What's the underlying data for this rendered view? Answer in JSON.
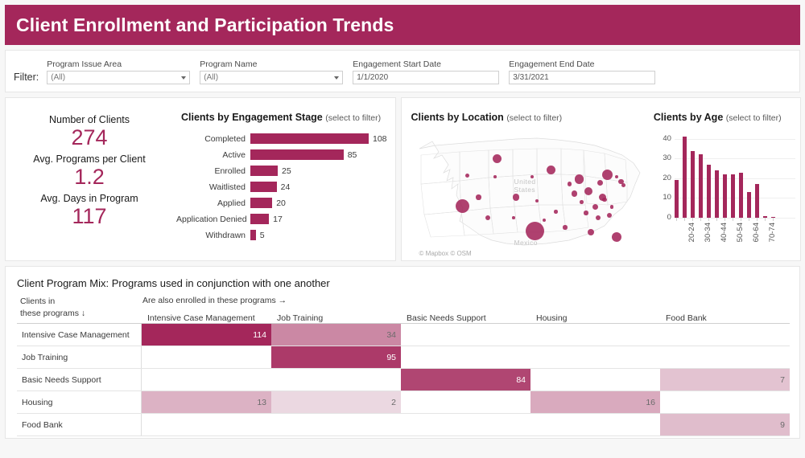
{
  "header": {
    "title": "Client Enrollment and Participation Trends",
    "accent": "#a4275b"
  },
  "filter": {
    "label": "Filter:",
    "controls": [
      {
        "name": "program-issue-area",
        "label": "Program Issue Area",
        "value": "(All)",
        "type": "select"
      },
      {
        "name": "program-name",
        "label": "Program Name",
        "value": "(All)",
        "type": "select"
      },
      {
        "name": "engagement-start-date",
        "label": "Engagement Start Date",
        "value": "1/1/2020",
        "type": "date"
      },
      {
        "name": "engagement-end-date",
        "label": "Engagement End Date",
        "value": "3/31/2021",
        "type": "date"
      }
    ]
  },
  "kpis": [
    {
      "label": "Number of Clients",
      "value": "274"
    },
    {
      "label": "Avg. Programs per Client",
      "value": "1.2"
    },
    {
      "label": "Avg. Days in Program",
      "value": "117"
    }
  ],
  "engagement_stage": {
    "title": "Clients by Engagement Stage",
    "subtitle": "(select to filter)",
    "chart_data": {
      "type": "bar",
      "title": "Clients by Engagement Stage",
      "xlabel": "",
      "ylabel": "",
      "orientation": "horizontal",
      "categories": [
        "Completed",
        "Active",
        "Enrolled",
        "Waitlisted",
        "Applied",
        "Application Denied",
        "Withdrawn"
      ],
      "values": [
        108,
        85,
        25,
        24,
        20,
        17,
        5
      ],
      "xlim": [
        0,
        108
      ],
      "color": "#a4275b",
      "grid": false
    }
  },
  "location": {
    "title": "Clients by Location",
    "subtitle": "(select to filter)",
    "attribution": "© Mapbox  © OSM",
    "map_labels": [
      "United States",
      "Mexico"
    ],
    "chart_data": {
      "type": "scatter",
      "title": "Clients by Location",
      "xlabel": "",
      "ylabel": "",
      "note": "Proportional symbol map of US client counts",
      "points": [
        {
          "x": 37,
          "y": 23,
          "r": 5.5
        },
        {
          "x": 24,
          "y": 37,
          "r": 2.5
        },
        {
          "x": 36,
          "y": 38,
          "r": 1.8
        },
        {
          "x": 22,
          "y": 62,
          "r": 8.5
        },
        {
          "x": 29,
          "y": 55,
          "r": 3.2
        },
        {
          "x": 33,
          "y": 72,
          "r": 3.2
        },
        {
          "x": 44,
          "y": 72,
          "r": 1.8
        },
        {
          "x": 45,
          "y": 55,
          "r": 4.2
        },
        {
          "x": 54,
          "y": 58,
          "r": 2.2
        },
        {
          "x": 52,
          "y": 38,
          "r": 1.9
        },
        {
          "x": 57,
          "y": 74,
          "r": 2.2
        },
        {
          "x": 53,
          "y": 83,
          "r": 11.5
        },
        {
          "x": 62,
          "y": 67,
          "r": 2.2
        },
        {
          "x": 60,
          "y": 32,
          "r": 5.5
        },
        {
          "x": 66,
          "y": 80,
          "r": 2.6
        },
        {
          "x": 68,
          "y": 44,
          "r": 2.7
        },
        {
          "x": 70,
          "y": 52,
          "r": 3.6
        },
        {
          "x": 72,
          "y": 40,
          "r": 5.6
        },
        {
          "x": 73,
          "y": 59,
          "r": 2.3
        },
        {
          "x": 75,
          "y": 68,
          "r": 2.6
        },
        {
          "x": 76,
          "y": 50,
          "r": 5.2
        },
        {
          "x": 77,
          "y": 84,
          "r": 4.0
        },
        {
          "x": 79,
          "y": 63,
          "r": 3.5
        },
        {
          "x": 80,
          "y": 72,
          "r": 3.0
        },
        {
          "x": 81,
          "y": 43,
          "r": 3.6
        },
        {
          "x": 82,
          "y": 55,
          "r": 4.8
        },
        {
          "x": 83,
          "y": 57,
          "r": 2.8
        },
        {
          "x": 84,
          "y": 36,
          "r": 6.5
        },
        {
          "x": 86,
          "y": 63,
          "r": 2.4
        },
        {
          "x": 88,
          "y": 38,
          "r": 2.0
        },
        {
          "x": 90,
          "y": 42,
          "r": 3.4
        },
        {
          "x": 91,
          "y": 45,
          "r": 2.4
        },
        {
          "x": 85,
          "y": 70,
          "r": 3.0
        },
        {
          "x": 88,
          "y": 88,
          "r": 6.0
        }
      ],
      "color": "#a4275b"
    }
  },
  "age": {
    "title": "Clients by Age",
    "subtitle": "(select to filter)",
    "chart_data": {
      "type": "bar",
      "title": "Clients by Age",
      "xlabel": "",
      "ylabel": "",
      "categories": [
        "15-19",
        "20-24",
        "25-29",
        "30-34",
        "35-39",
        "40-44",
        "45-49",
        "50-54",
        "55-59",
        "60-64",
        "65-69",
        "70-74",
        "75-79"
      ],
      "tick_labels": [
        "",
        "20-24",
        "",
        "30-34",
        "",
        "40-44",
        "",
        "50-54",
        "",
        "60-64",
        "",
        "70-74",
        ""
      ],
      "values": [
        19,
        41,
        34,
        32,
        27,
        24,
        22,
        22,
        23,
        13,
        17,
        1,
        0.4
      ],
      "yticks": [
        0,
        10,
        20,
        30,
        40
      ],
      "ylim": [
        0,
        44
      ],
      "color": "#a4275b",
      "grid": true
    }
  },
  "program_mix": {
    "title": "Client Program Mix: Programs used in conjunction with one another",
    "row_axis_label": "Clients in\nthese programs ↓",
    "row_axis_line1": "Clients in",
    "row_axis_line2": "these programs ↓",
    "col_axis_label": "Are also enrolled in these programs →",
    "columns": [
      "Intensive Case Management",
      "Job Training",
      "Basic Needs Support",
      "Housing",
      "Food Bank"
    ],
    "rows": [
      "Intensive Case Management",
      "Job Training",
      "Basic Needs Support",
      "Housing",
      "Food Bank"
    ],
    "chart_data": {
      "type": "heatmap",
      "title": "Client Program Mix: Programs used in conjunction with one another",
      "xlabel": "Are also enrolled in these programs →",
      "ylabel": "Clients in these programs ↓",
      "x_categories": [
        "Intensive Case Management",
        "Job Training",
        "Basic Needs Support",
        "Housing",
        "Food Bank"
      ],
      "y_categories": [
        "Intensive Case Management",
        "Job Training",
        "Basic Needs Support",
        "Housing",
        "Food Bank"
      ],
      "cells": [
        [
          114,
          34,
          null,
          null,
          null
        ],
        [
          null,
          95,
          null,
          null,
          null
        ],
        [
          null,
          null,
          84,
          null,
          7
        ],
        [
          13,
          2,
          null,
          16,
          null
        ],
        [
          null,
          null,
          null,
          null,
          9
        ]
      ],
      "vmax": 114,
      "color": "#a4275b"
    }
  }
}
